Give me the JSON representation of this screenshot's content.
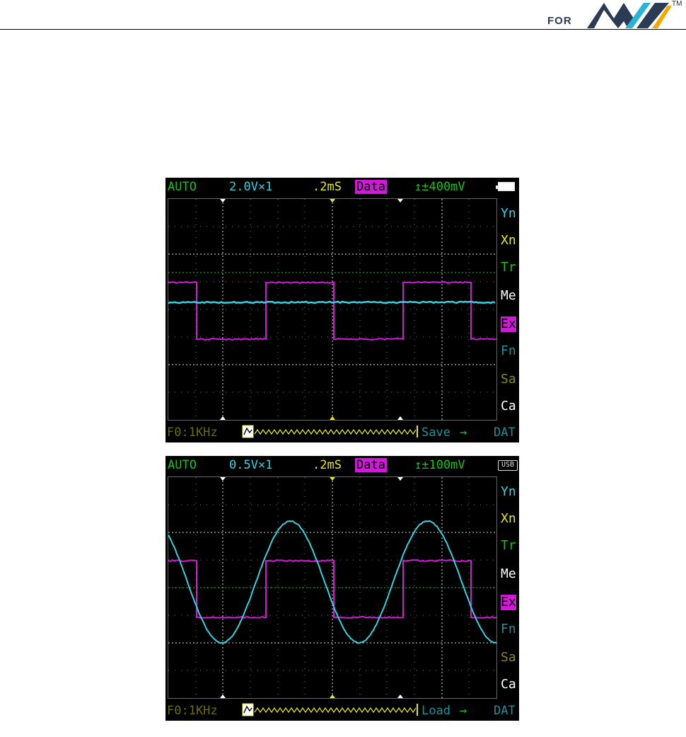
{
  "header": {
    "brand_prefix": "FOR",
    "trademark": "TM",
    "logo_icon": "brand-logo-icon",
    "logo_colors": [
      "#2b3a55",
      "#2bb3d6",
      "#f2a900"
    ]
  },
  "screens": [
    {
      "status": {
        "mode": "AUTO",
        "vdiv": "2.0V×1",
        "tdiv": ".2mS",
        "data_label": "Data",
        "trigger": "↥±400mV",
        "indicator_icon": "battery-icon"
      },
      "menu": [
        "Yn",
        "Xn",
        "Tr",
        "Me",
        "Ex",
        "Fn",
        "Sa",
        "Ca"
      ],
      "bottom": {
        "freq": "F0:1KHz",
        "file_icon": "file-waveform-icon",
        "action": "Save",
        "arrow": "→",
        "tail": "DAT"
      },
      "colors": {
        "primary": "#d01ad8",
        "secondary": "#3ad0e0"
      }
    },
    {
      "status": {
        "mode": "AUTO",
        "vdiv": "0.5V×1",
        "tdiv": ".2mS",
        "data_label": "Data",
        "trigger": "↥±100mV",
        "indicator_icon": "usb-icon",
        "usb_label": "USB"
      },
      "menu": [
        "Yn",
        "Xn",
        "Tr",
        "Me",
        "Ex",
        "Fn",
        "Sa",
        "Ca"
      ],
      "bottom": {
        "freq": "F0:1KHz",
        "file_icon": "file-waveform-icon",
        "action": "Load",
        "arrow": "→",
        "tail": "DAT"
      },
      "colors": {
        "primary": "#d01ad8",
        "secondary": "#3ad0e0"
      }
    }
  ]
}
